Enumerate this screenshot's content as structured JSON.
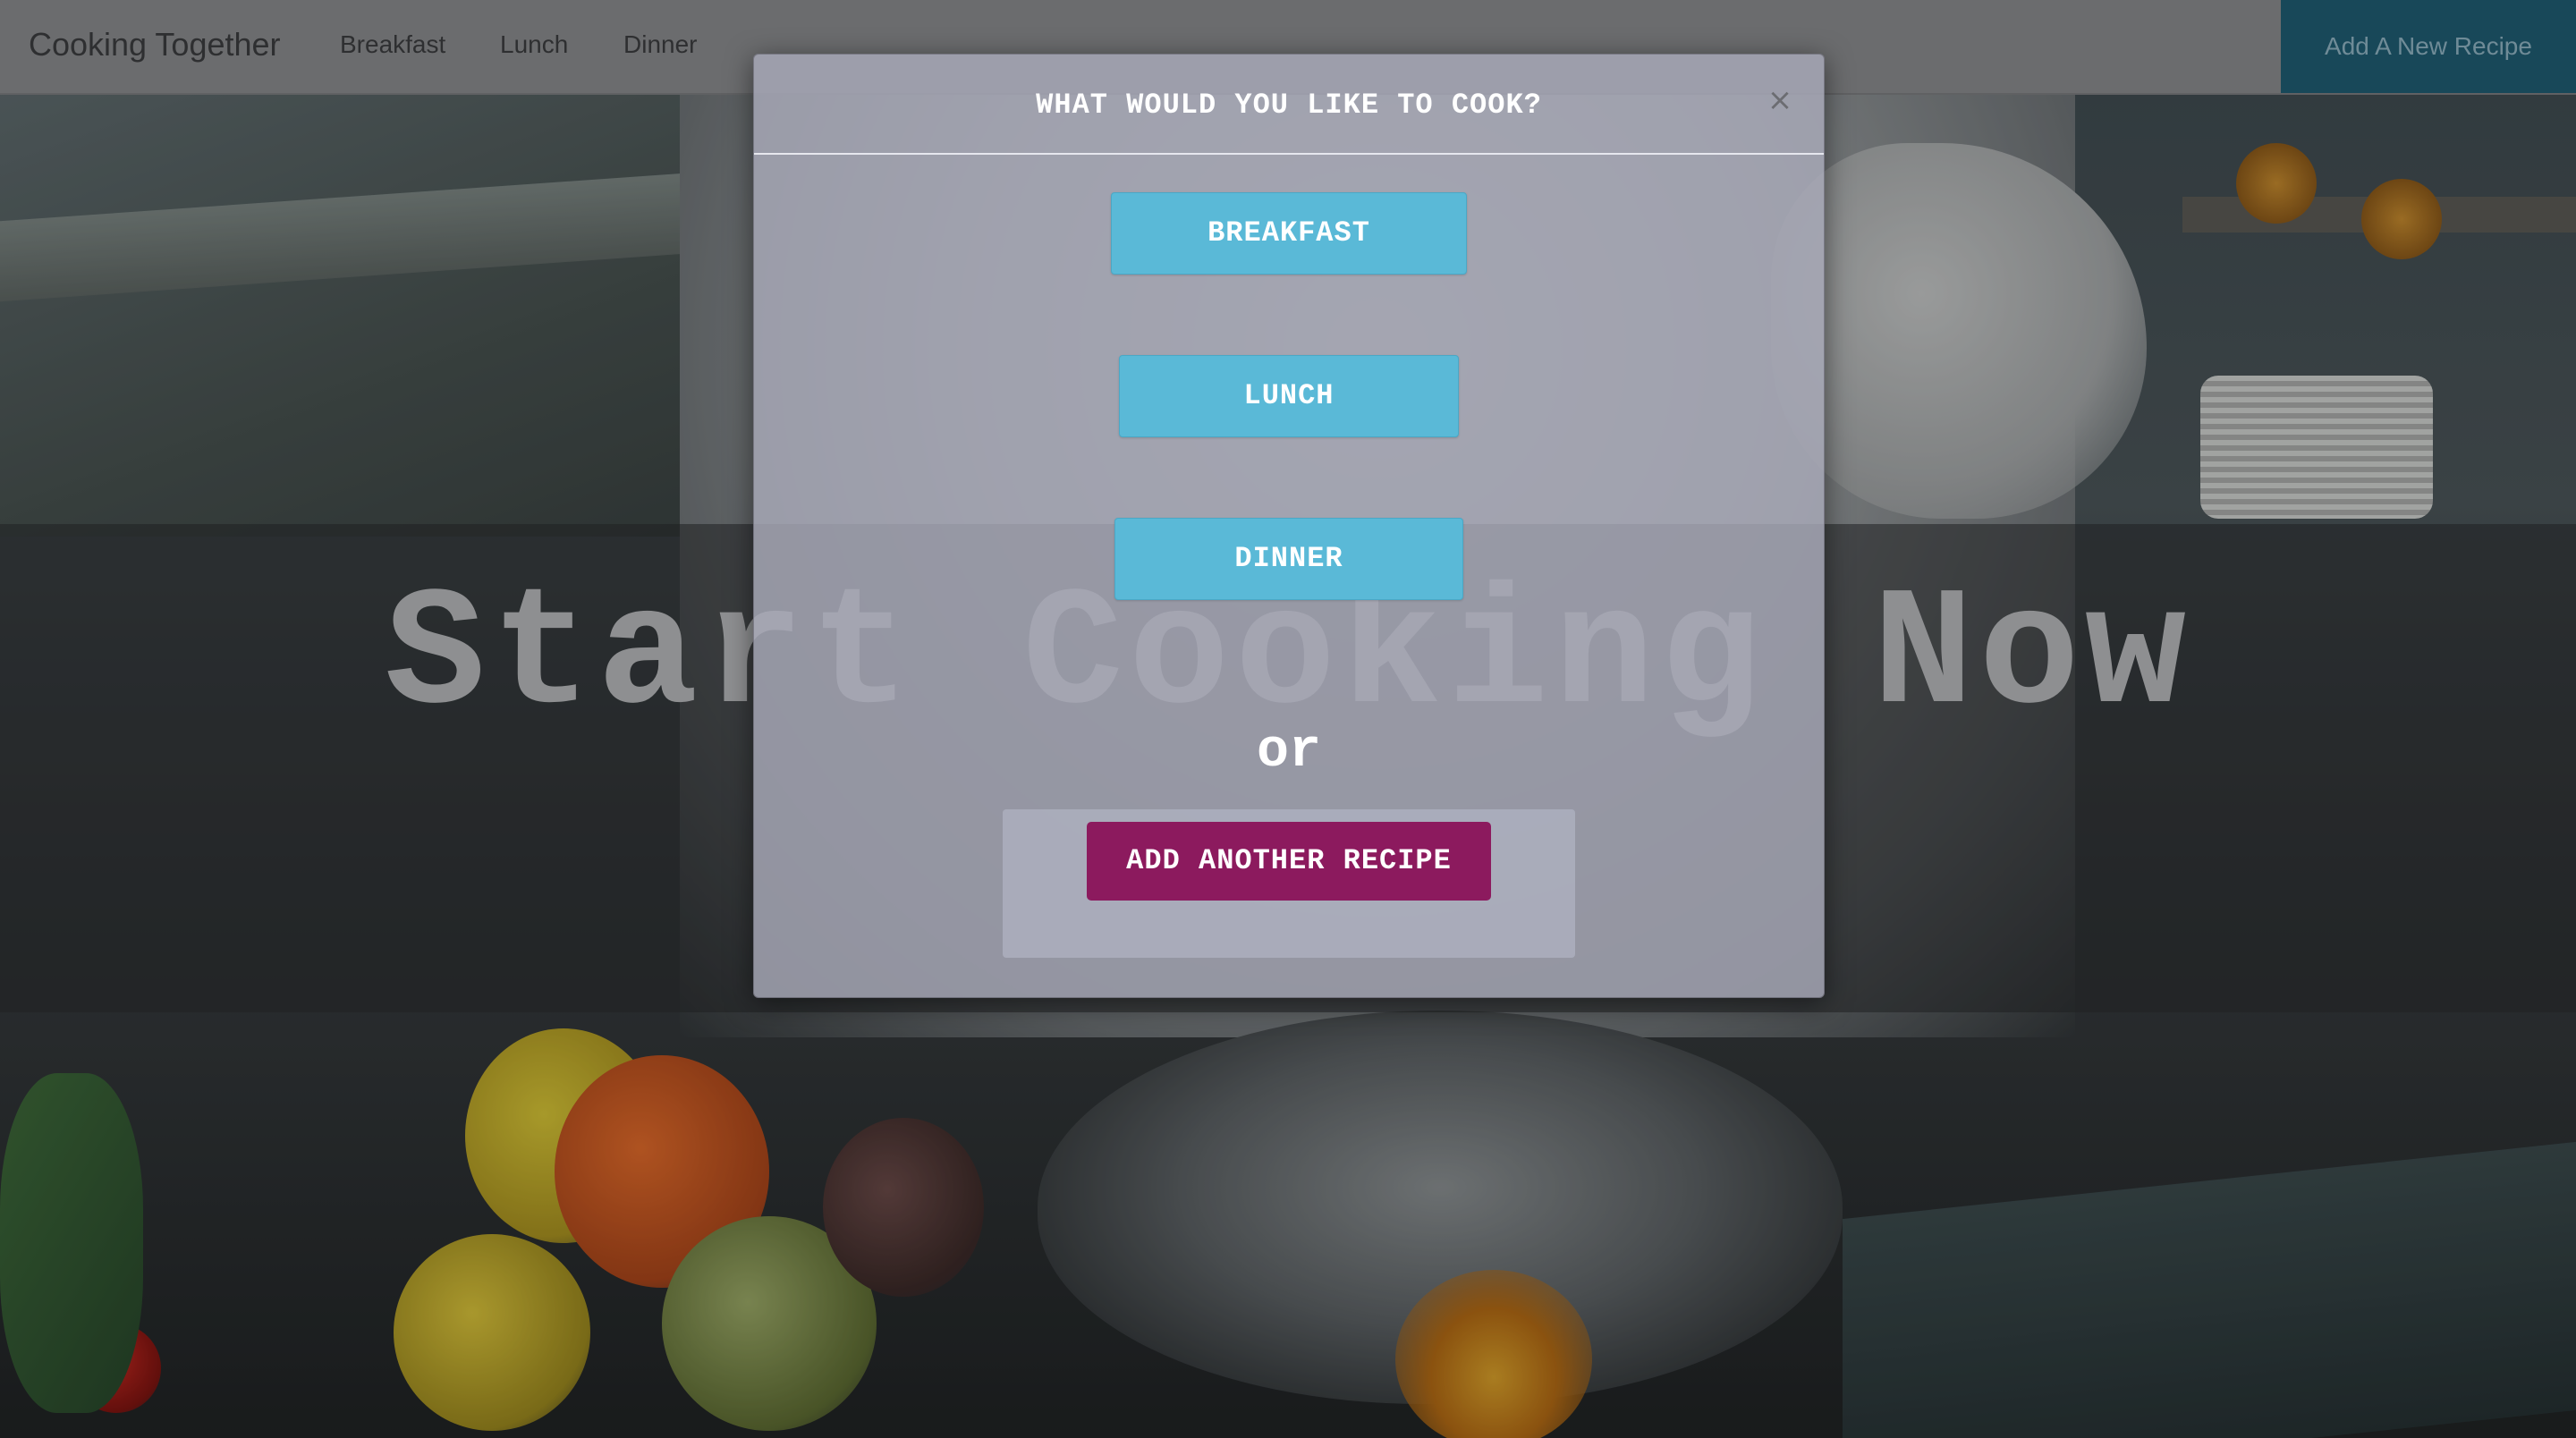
{
  "navbar": {
    "brand": "Cooking Together",
    "links": [
      "Breakfast",
      "Lunch",
      "Dinner"
    ],
    "add_recipe_label": "Add A New Recipe"
  },
  "hero": {
    "title": "Start Cooking Now"
  },
  "modal": {
    "title": "WHAT WOULD YOU LIKE TO COOK?",
    "close_glyph": "×",
    "buttons": {
      "breakfast": "BREAKFAST",
      "lunch": "LUNCH",
      "dinner": "DINNER"
    },
    "or_text": "or",
    "add_another_label": "ADD ANOTHER RECIPE"
  },
  "colors": {
    "meal_button": "#5ab9d7",
    "add_button": "#8c1a5e",
    "nav_add_button": "#1f5d72"
  }
}
